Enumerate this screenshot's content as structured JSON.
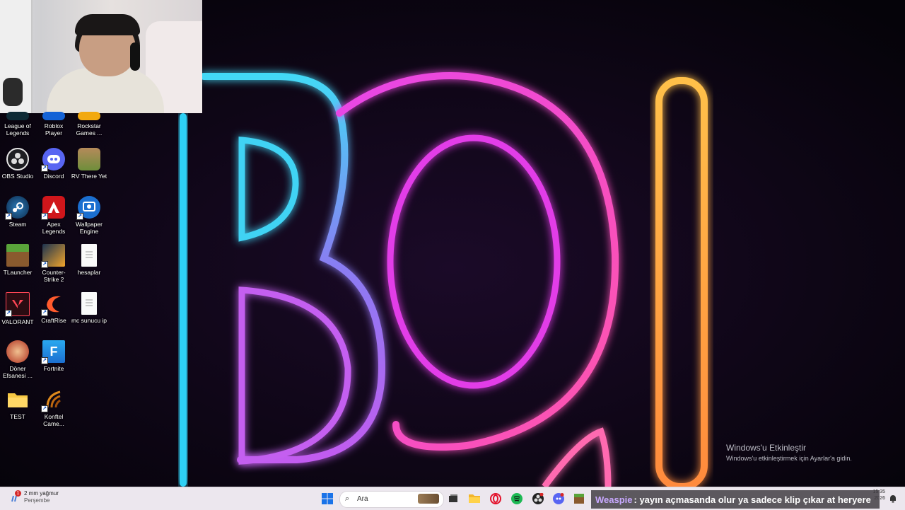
{
  "desktop": {
    "icons": [
      {
        "label": "League of Legends",
        "icon": "league-of-legends-icon"
      },
      {
        "label": "Roblox Player",
        "icon": "roblox-icon"
      },
      {
        "label": "Rockstar Games ...",
        "icon": "rockstar-icon"
      },
      {
        "label": "OBS Studio",
        "icon": "obs-icon"
      },
      {
        "label": "Discord",
        "icon": "discord-icon"
      },
      {
        "label": "RV There Yet",
        "icon": "rv-there-yet-icon"
      },
      {
        "label": "Steam",
        "icon": "steam-icon"
      },
      {
        "label": "Apex Legends",
        "icon": "apex-icon"
      },
      {
        "label": "Wallpaper Engine",
        "icon": "wallpaper-engine-icon"
      },
      {
        "label": "TLauncher",
        "icon": "tlauncher-icon"
      },
      {
        "label": "Counter-Strike 2",
        "icon": "counter-strike-icon"
      },
      {
        "label": "hesaplar",
        "icon": "text-file-icon"
      },
      {
        "label": "VALORANT",
        "icon": "valorant-icon"
      },
      {
        "label": "CraftRise",
        "icon": "craftrise-icon"
      },
      {
        "label": "mc sunucu ip",
        "icon": "text-file-icon"
      },
      {
        "label": "Döner Efsanesi ...",
        "icon": "doner-efsanesi-icon"
      },
      {
        "label": "Fortnite",
        "icon": "fortnite-icon"
      },
      {
        "label": "TEST",
        "icon": "folder-icon"
      },
      {
        "label": "Konftel Came...",
        "icon": "konftel-icon"
      }
    ],
    "wallpaper_logo": "BOI"
  },
  "activation": {
    "title": "Windows'u Etkinleştir",
    "subtitle": "Windows'u etkinleştirmek için Ayarlar'a gidin."
  },
  "taskbar": {
    "weather": {
      "line1": "2 mm yağmur",
      "line2": "Perşembe",
      "badge": "1"
    },
    "search_placeholder": "Ara",
    "clock": {
      "time": "15:35",
      "date": "2026"
    }
  },
  "chat_overlay": {
    "user": "Weaspie",
    "message": ": yayın açmasanda olur ya sadece klip çıkar at heryere"
  },
  "colors": {
    "taskbar_bg": "#ece7ee",
    "neon_cyan": "#37d7f5",
    "neon_pink": "#e83cf0",
    "neon_orange": "#ff8a3c"
  }
}
